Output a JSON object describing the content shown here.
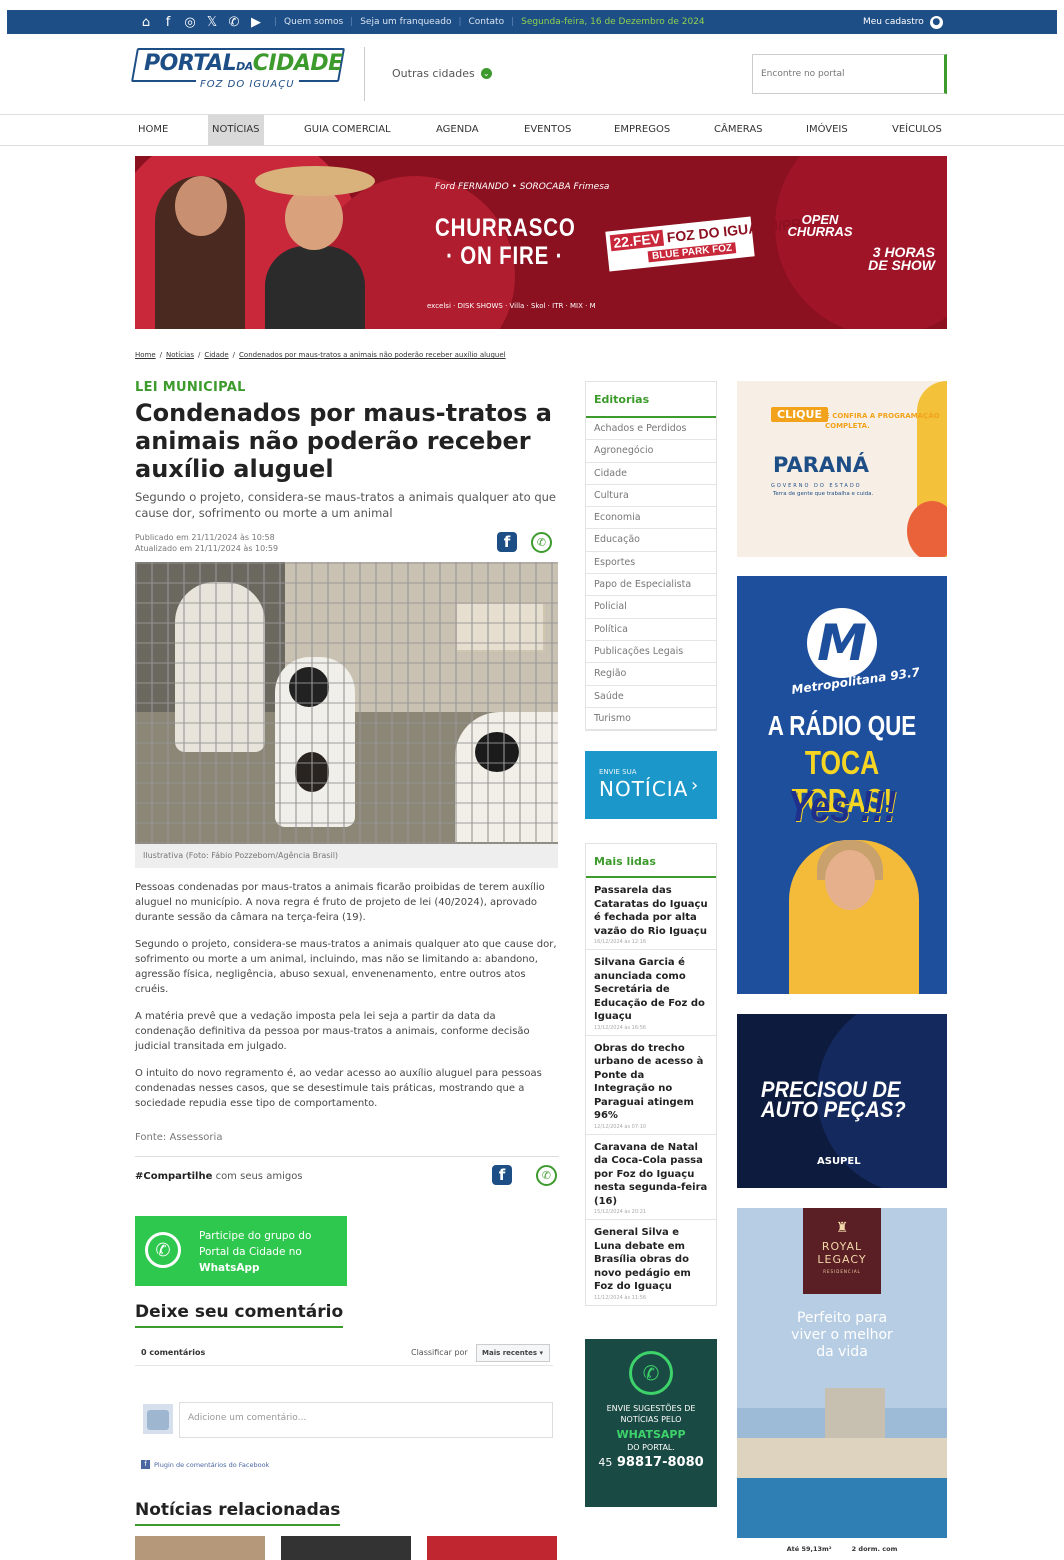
{
  "topbar": {
    "links": [
      "Quem somos",
      "Seja um franqueado",
      "Contato"
    ],
    "date": "Segunda-feira, 16 de Dezembro de 2024",
    "account": "Meu cadastro"
  },
  "header": {
    "logo_main": "PORTAL",
    "logo_da": "DA",
    "logo_city": "CIDADE",
    "logo_sub": "FOZ DO IGUAÇU",
    "other_cities": "Outras cidades",
    "search_placeholder": "Encontre no portal"
  },
  "nav": [
    "HOME",
    "NOTÍCIAS",
    "GUIA COMERCIAL",
    "AGENDA",
    "EVENTOS",
    "EMPREGOS",
    "CÂMERAS",
    "IMÓVEIS",
    "VEÍCULOS"
  ],
  "banner": {
    "sponsors": "Ford   FERNANDO • SOROCABA   Frimesa",
    "title_1": "CHURRASCO",
    "title_2": "· ON FIRE ·",
    "date_label": "22.FEV",
    "place": "FOZ DO IGUAÇU/PR",
    "venue": "BLUE PARK FOZ",
    "open_1": "OPEN",
    "open_2": "CHURRAS",
    "show_1": "3 HORAS",
    "show_2": "DE SHOW",
    "logos": "excelsi  ·  DISK SHOWS  ·  Villa  ·  Skol  ·  ITR  ·  MIX  ·  M"
  },
  "breadcrumb": [
    "Home",
    "Notícias",
    "Cidade",
    "Condenados por maus-tratos a animais não poderão receber auxílio aluguel"
  ],
  "article": {
    "category": "LEI MUNICIPAL",
    "title": "Condenados por maus-tratos a animais não poderão receber auxílio aluguel",
    "lede": "Segundo o projeto, considera-se maus-tratos a animais qualquer ato que cause dor, sofrimento ou morte a um animal",
    "published": "Publicado em 21/11/2024 às 10:58",
    "updated": "Atualizado em 21/11/2024 às 10:59",
    "caption": "Ilustrativa (Foto: Fábio Pozzebom/Agência Brasil)",
    "paragraphs": [
      "Pessoas condenadas por maus-tratos a animais ficarão proibidas de terem auxílio aluguel no município. A nova regra é fruto de projeto de lei (40/2024), aprovado durante sessão da câmara na terça-feira (19).",
      "Segundo o projeto, considera-se maus-tratos a animais qualquer ato que cause dor, sofrimento ou morte a um animal, incluindo, mas não se limitando a: abandono, agressão física, negligência, abuso sexual, envenenamento, entre outros atos cruéis.",
      "A matéria prevê que a vedação imposta pela lei seja a partir da data da condenação definitiva da pessoa por maus-tratos a animais, conforme decisão judicial transitada em julgado.",
      "O intuito do novo regramento é, ao vedar acesso ao auxílio aluguel para pessoas condenadas nesses casos, que se desestimule tais práticas, mostrando que a sociedade repudia esse tipo de comportamento."
    ],
    "source": "Fonte: Assessoria",
    "share_tag": "#Compartilhe",
    "share_text": " com seus amigos"
  },
  "whatsapp_group": {
    "line1": "Participe do grupo do",
    "line2": "Portal da Cidade no",
    "line3": "WhatsApp"
  },
  "comments": {
    "heading": "Deixe seu comentário",
    "count": "0 comentários",
    "sort_label": "Classificar por",
    "sort_value": "Mais recentes ▾",
    "placeholder": "Adicione um comentário...",
    "plugin": "Plugin de comentários do Facebook"
  },
  "related": {
    "heading": "Notícias relacionadas"
  },
  "editorias": {
    "heading": "Editorias",
    "items": [
      "Achados e Perdidos",
      "Agronegócio",
      "Cidade",
      "Cultura",
      "Economia",
      "Educação",
      "Esportes",
      "Papo de Especialista",
      "Policial",
      "Política",
      "Publicações Legais",
      "Região",
      "Saúde",
      "Turismo"
    ]
  },
  "envie": {
    "small": "ENVIE SUA",
    "big": "NOTÍCIA",
    "arrow": "›"
  },
  "mais_lidas": {
    "heading": "Mais lidas",
    "items": [
      {
        "title": "Passarela das Cataratas do Iguaçu é fechada por alta vazão do Rio Iguaçu",
        "date": "16/12/2024 às 12:16"
      },
      {
        "title": "Silvana Garcia é anunciada como Secretária de Educação de Foz do Iguaçu",
        "date": "13/12/2024 às 16:56"
      },
      {
        "title": "Obras do trecho urbano de acesso à Ponte da Integração no Paraguai atingem 96%",
        "date": "12/12/2024 às 07:10"
      },
      {
        "title": "Caravana de Natal da Coca-Cola passa por Foz do Iguaçu nesta segunda-feira (16)",
        "date": "15/12/2024 às 20:21"
      },
      {
        "title": "General Silva e Luna debate em Brasília obras do novo pedágio em Foz do Iguaçu",
        "date": "11/12/2024 às 11:56"
      }
    ]
  },
  "wa_box": {
    "line1": "ENVIE SUGESTÕES DE",
    "line2": "NOTÍCIAS PELO",
    "line3": "WHATSAPP",
    "line4": "DO PORTAL.",
    "ddd": "45",
    "number": "98817-8080"
  },
  "ads": {
    "parana_clique": "CLIQUE",
    "parana_cta": "E CONFIRA A PROGRAMAÇÃO COMPLETA.",
    "parana_name": "PARANÁ",
    "parana_gov": "GOVERNO DO ESTADO",
    "parana_slogan": "Terra de gente que trabalha e cuida.",
    "radio_letter": "M",
    "radio_name": "Metropolitana 93.7",
    "radio_l1": "A RÁDIO QUE",
    "radio_l2": "TOCA TODAS!",
    "radio_l3": "Yes !!!",
    "auto_1": "PRECISOU DE",
    "auto_2": "AUTO PEÇAS?",
    "auto_brand": "ASUPEL",
    "royal_1": "ROYAL",
    "royal_2": "LEGACY",
    "royal_sub": "RESIDENCIAL",
    "royal_h1": "Perfeito para",
    "royal_h2": "viver o melhor",
    "royal_h3": "da vida",
    "royal_f1": "Até 59,13m²",
    "royal_f2": "2 dorm. com"
  },
  "colors": {
    "brand_blue": "#1e4e86",
    "brand_green": "#3c9b2c",
    "whatsapp": "#2fc84f"
  }
}
